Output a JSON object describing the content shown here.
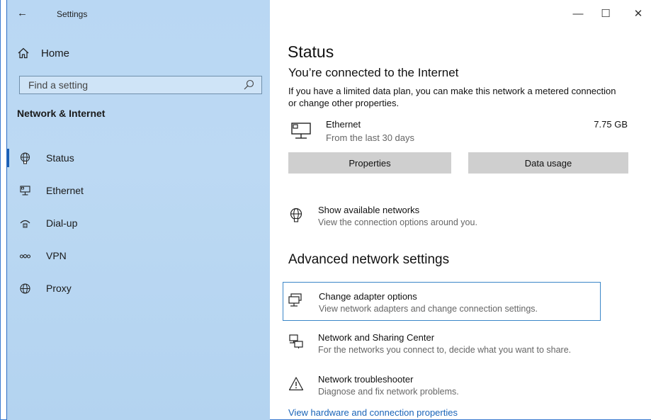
{
  "window": {
    "app_title": "Settings",
    "back_glyph": "←",
    "minimize_glyph": "—",
    "maximize_glyph": "☐",
    "close_glyph": "✕"
  },
  "sidebar": {
    "home_label": "Home",
    "search_placeholder": "Find a setting",
    "section_label": "Network & Internet",
    "items": [
      {
        "label": "Status",
        "icon": "status-globe-icon",
        "active": true
      },
      {
        "label": "Ethernet",
        "icon": "ethernet-icon",
        "active": false
      },
      {
        "label": "Dial-up",
        "icon": "dialup-icon",
        "active": false
      },
      {
        "label": "VPN",
        "icon": "vpn-icon",
        "active": false
      },
      {
        "label": "Proxy",
        "icon": "proxy-globe-icon",
        "active": false
      }
    ]
  },
  "main": {
    "title": "Status",
    "connection_heading": "You’re connected to the Internet",
    "connection_desc": "If you have a limited data plan, you can make this network a metered connection or change other properties.",
    "ethernet": {
      "name": "Ethernet",
      "subtitle": "From the last 30 days",
      "usage": "7.75 GB"
    },
    "buttons": {
      "properties": "Properties",
      "data_usage": "Data usage"
    },
    "show_networks": {
      "title": "Show available networks",
      "subtitle": "View the connection options around you."
    },
    "advanced_heading": "Advanced network settings",
    "adapter": {
      "title": "Change adapter options",
      "subtitle": "View network adapters and change connection settings."
    },
    "sharing": {
      "title": "Network and Sharing Center",
      "subtitle": "For the networks you connect to, decide what you want to share."
    },
    "troubleshooter": {
      "title": "Network troubleshooter",
      "subtitle": "Diagnose and fix network problems."
    },
    "hardware_link": "View hardware and connection properties"
  },
  "colors": {
    "sidebar_bg": "#b9d7f3",
    "accent": "#1a64b8",
    "button_bg": "#cfcfcf",
    "focus_border": "#3a86c8"
  }
}
